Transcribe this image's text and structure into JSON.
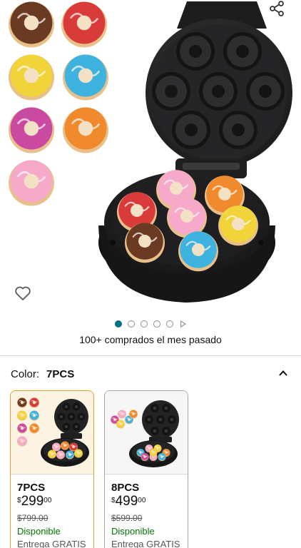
{
  "hero": {
    "thumbnails": [
      "chocolate",
      "red",
      "yellow",
      "blue",
      "purple",
      "orange",
      "pink"
    ],
    "icons": {
      "share": "share-icon",
      "wishlist": "heart-icon"
    },
    "carousel": {
      "count": 5,
      "active": 1,
      "has_video": true
    }
  },
  "bought_text": "100+ comprados el mes pasado",
  "color": {
    "label": "Color:",
    "value": "7PCS"
  },
  "variants": [
    {
      "name": "7PCS",
      "currency": "$",
      "price_whole": "299",
      "price_fraction": "00",
      "list_price": "$799.00",
      "availability": "Disponible",
      "shipping": "Entrega GRATIS",
      "selected": true
    },
    {
      "name": "8PCS",
      "currency": "$",
      "price_whole": "499",
      "price_fraction": "00",
      "list_price": "$599.00",
      "availability": "Disponible",
      "shipping": "Entrega GRATIS",
      "selected": false
    }
  ],
  "colors": {
    "accent": "#007185",
    "selected_border": "#e3a32e",
    "in_stock": "#007600",
    "appliance": "#2a2a2c"
  }
}
